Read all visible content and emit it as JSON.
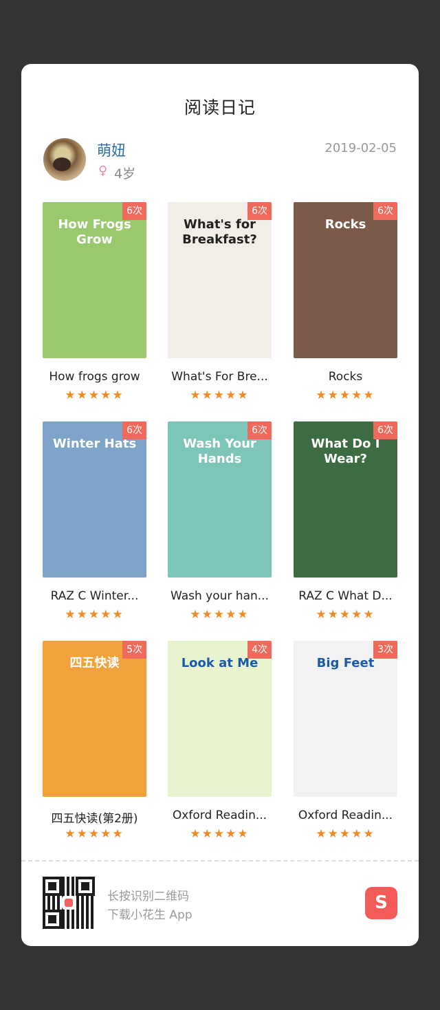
{
  "title": "阅读日记",
  "user": {
    "name": "萌妞",
    "gender_symbol": "♀",
    "age": "4岁"
  },
  "date": "2019-02-05",
  "books": [
    {
      "title": "How frogs grow",
      "count": "6次",
      "rating": 5,
      "cover_text": "How Frogs Grow",
      "cover_bg": "#9bc96e",
      "cover_fg": "#fff"
    },
    {
      "title": "What's For Bre...",
      "count": "6次",
      "rating": 5,
      "cover_text": "What's for Breakfast?",
      "cover_bg": "#f2ede6",
      "cover_fg": "#222"
    },
    {
      "title": "Rocks",
      "count": "6次",
      "rating": 5,
      "cover_text": "Rocks",
      "cover_bg": "#7b5a4a",
      "cover_fg": "#fff"
    },
    {
      "title": "RAZ C Winter...",
      "count": "6次",
      "rating": 5,
      "cover_text": "Winter Hats",
      "cover_bg": "#7ea5c9",
      "cover_fg": "#fff"
    },
    {
      "title": "Wash your han...",
      "count": "6次",
      "rating": 5,
      "cover_text": "Wash Your Hands",
      "cover_bg": "#7ec5b9",
      "cover_fg": "#fff"
    },
    {
      "title": "RAZ C What D...",
      "count": "6次",
      "rating": 5,
      "cover_text": "What Do I Wear?",
      "cover_bg": "#3d6c43",
      "cover_fg": "#fff"
    },
    {
      "title": "四五快读(第2册)",
      "count": "5次",
      "rating": 5,
      "cover_text": "四五快读",
      "cover_bg": "#f2a23a",
      "cover_fg": "#fff"
    },
    {
      "title": "Oxford Readin...",
      "count": "4次",
      "rating": 5,
      "cover_text": "Look at Me",
      "cover_bg": "#e8f3cf",
      "cover_fg": "#1c5aa6"
    },
    {
      "title": "Oxford Readin...",
      "count": "3次",
      "rating": 5,
      "cover_text": "Big Feet",
      "cover_bg": "#f2f2f2",
      "cover_fg": "#1c5aa6"
    }
  ],
  "footer": {
    "line1": "长按识别二维码",
    "line2": "下载小花生 App",
    "app_icon_glyph": "S"
  },
  "colors": {
    "accent": "#f06a5c",
    "star": "#f08a24",
    "name": "#2c6fa8"
  },
  "icons": {
    "gender": "female-icon",
    "qr": "qr-code-icon",
    "app": "app-logo-icon"
  }
}
